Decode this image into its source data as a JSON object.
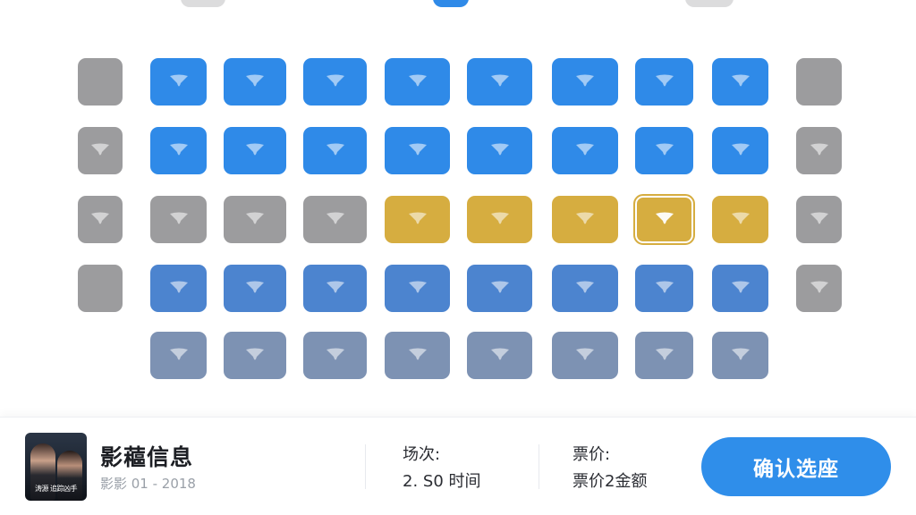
{
  "colors": {
    "available_blue": "#2f8ae8",
    "row4_blue": "#4c84cf",
    "row5_slate": "#7d92b3",
    "reserved_gray": "#9c9c9e",
    "premium_gold": "#d6ad40",
    "confirm_button": "#2f8eea"
  },
  "seat_rows": [
    [
      "gray-side",
      "blue",
      "blue",
      "blue",
      "blue",
      "blue",
      "blue",
      "blue",
      "blue",
      "gray-side"
    ],
    [
      "gray-side",
      "blue",
      "blue",
      "blue",
      "blue",
      "blue",
      "blue",
      "blue",
      "blue",
      "gray-side"
    ],
    [
      "gray-side",
      "gray",
      "gray",
      "gray",
      "gold",
      "gold",
      "gold",
      "gold-selected",
      "gold",
      "gray-side"
    ],
    [
      "gray-side",
      "mid",
      "mid",
      "mid",
      "mid",
      "mid",
      "mid",
      "mid",
      "mid",
      "gray-side"
    ],
    [
      "none",
      "slate",
      "slate",
      "slate",
      "slate",
      "slate",
      "slate",
      "slate",
      "slate",
      "none"
    ]
  ],
  "movie": {
    "poster_text": "涛源 追踪凶手",
    "title": "影藲信息",
    "subtitle": "影影 01 - 2018"
  },
  "showtime": {
    "label": "场次:",
    "value": "2. S0 时间"
  },
  "price": {
    "label": "票价:",
    "value": "票价2金额"
  },
  "confirm_button": {
    "label": "确认选座"
  }
}
